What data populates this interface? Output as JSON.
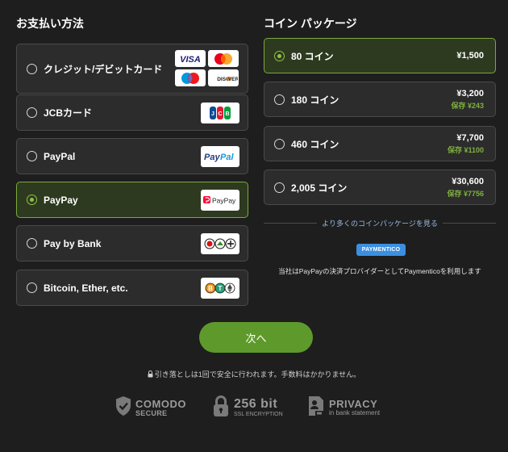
{
  "payment": {
    "title": "お支払い方法",
    "options": [
      {
        "label": "クレジット/デビットカード",
        "selected": false
      },
      {
        "label": "JCBカード",
        "selected": false,
        "logo": "JCB"
      },
      {
        "label": "PayPal",
        "selected": false,
        "logo": "PayPal"
      },
      {
        "label": "PayPay",
        "selected": true,
        "logo": "PayPay"
      },
      {
        "label": "Pay by Bank",
        "selected": false
      },
      {
        "label": "Bitcoin, Ether, etc.",
        "selected": false
      }
    ],
    "card_logos": [
      "VISA",
      "mastercard",
      "maestro",
      "DISCOVER"
    ]
  },
  "packages": {
    "title": "コイン パッケージ",
    "items": [
      {
        "label": "80 コイン",
        "price": "¥1,500",
        "save": "",
        "selected": true
      },
      {
        "label": "180 コイン",
        "price": "¥3,200",
        "save": "保存 ¥243",
        "selected": false
      },
      {
        "label": "460 コイン",
        "price": "¥7,700",
        "save": "保存 ¥1100",
        "selected": false
      },
      {
        "label": "2,005 コイン",
        "price": "¥30,600",
        "save": "保存 ¥7756",
        "selected": false
      }
    ],
    "more_link": "より多くのコインパッケージを見る",
    "provider_badge": "PAYMENTICO",
    "provider_note": "当社はPayPayの決済プロバイダーとしてPaymenticoを利用します"
  },
  "next_button": "次へ",
  "notice": "引き落としは1回で安全に行われます。手数料はかかりません。",
  "trust": {
    "comodo_top": "COMODO",
    "comodo_bottom": "SECURE",
    "ssl_top": "256 bit",
    "ssl_bottom": "SSL ENCRYPTION",
    "privacy_top": "PRIVACY",
    "privacy_bottom": "in bank statement"
  },
  "colors": {
    "background": "#1e1e1e",
    "card": "#2c2c2c",
    "selected_bg": "#2e3a1f",
    "accent": "#7aa93c",
    "button": "#5e9a2b",
    "save_text": "#7fb03f",
    "link": "#9ab8e0"
  }
}
